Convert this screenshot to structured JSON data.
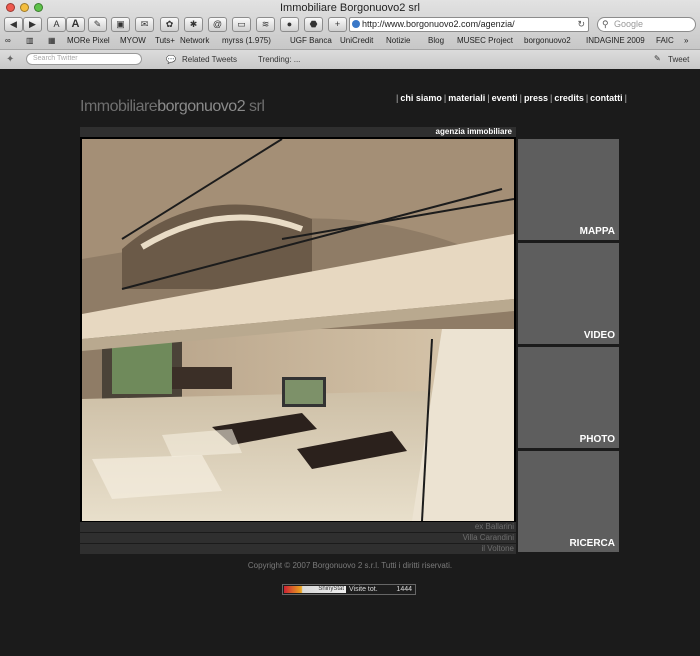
{
  "window": {
    "title": "Immobiliare Borgonuovo2 srl",
    "url": "http://www.borgonuovo2.com/agenzia/",
    "search_placeholder": "Google"
  },
  "toolbar": {
    "buttons": [
      "A",
      "A"
    ]
  },
  "bookmarks": [
    "MORe Pixel",
    "MYOW",
    "Tuts+",
    "Network",
    "myrss (1.975)",
    "UGF Banca",
    "UniCredit",
    "Notizie",
    "Blog",
    "MUSEC Project",
    "borgonuovo2",
    "INDAGINE 2009",
    "FAIC"
  ],
  "twitter": {
    "search_placeholder": "Search Twitter",
    "related": "Related Tweets",
    "trending": "Trending: ...",
    "tweet": "Tweet"
  },
  "site": {
    "logo_light": "Immobiliare",
    "logo_bold": "borgonuovo2",
    "logo_suffix": " srl",
    "nav": [
      "chi siamo",
      "materiali",
      "eventi",
      "press",
      "credits",
      "contatti"
    ],
    "section_label": "agenzia immobiliare",
    "side_panels": [
      "MAPPA",
      "VIDEO",
      "PHOTO",
      "RICERCA"
    ],
    "captions": [
      "ex Ballarini",
      "Villa Carandini",
      "il Voltone"
    ],
    "copyright": "Copyright © 2007 Borgonuovo 2 s.r.l. Tutti i diritti riservati.",
    "counter_brand": "ShinyStat",
    "counter_label": "Visite tot.",
    "counter_value": "1444"
  },
  "colors": {
    "page_background": "#1b1b1b",
    "panel_grey": "#5e5e5e",
    "bar_dark": "#2f2f2f"
  }
}
